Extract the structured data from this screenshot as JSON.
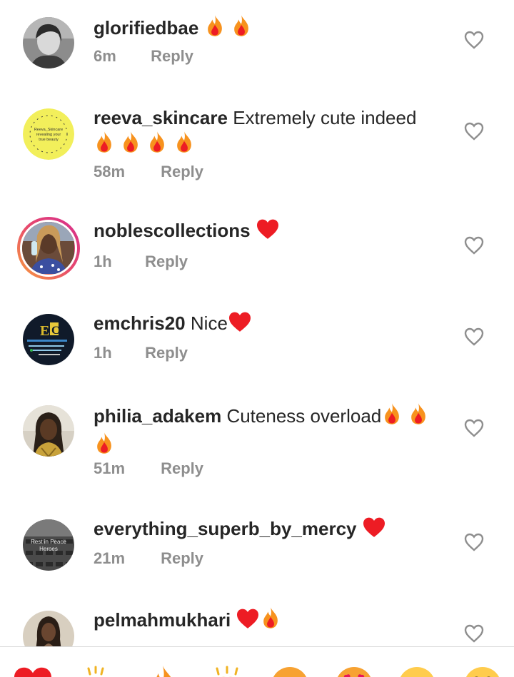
{
  "comments": [
    {
      "username": "glorifiedbae",
      "text": "",
      "emoji": [
        "fire",
        "fire"
      ],
      "time": "6m",
      "reply": "Reply"
    },
    {
      "username": "reeva_skincare",
      "text": "Extremely cute indeed",
      "emoji": [
        "fire",
        "fire",
        "fire",
        "fire"
      ],
      "time": "58m",
      "reply": "Reply",
      "avatar_text": "Reeva_Skincare revealing your true beauty"
    },
    {
      "username": "noblescollections",
      "text": "",
      "emoji": [
        "heart"
      ],
      "time": "1h",
      "reply": "Reply"
    },
    {
      "username": "emchris20",
      "text": "Nice",
      "emoji": [
        "heart"
      ],
      "time": "1h",
      "reply": "Reply"
    },
    {
      "username": "philia_adakem",
      "text": "Cuteness overload",
      "emoji": [
        "fire",
        "fire",
        "fire"
      ],
      "time": "51m",
      "reply": "Reply"
    },
    {
      "username": "everything_superb_by_mercy",
      "text": "",
      "emoji": [
        "heart"
      ],
      "time": "21m",
      "reply": "Reply",
      "avatar_text": "Rest in Peace Heroes"
    },
    {
      "username": "pelmahmukhari",
      "text": "",
      "emoji": [
        "heart",
        "fire"
      ],
      "time": "",
      "reply": ""
    }
  ],
  "colors": {
    "username": "#262626",
    "meta": "#8e8e8e",
    "heart": "#ed1c24",
    "fire": "#f7921e",
    "story_ring": "#e74a6d"
  },
  "reaction_bar": [
    "heart",
    "clapping-hands",
    "fire",
    "raising-hands",
    "crying-face",
    "heart-eyes-face",
    "surprised-face",
    "laughing-face"
  ]
}
